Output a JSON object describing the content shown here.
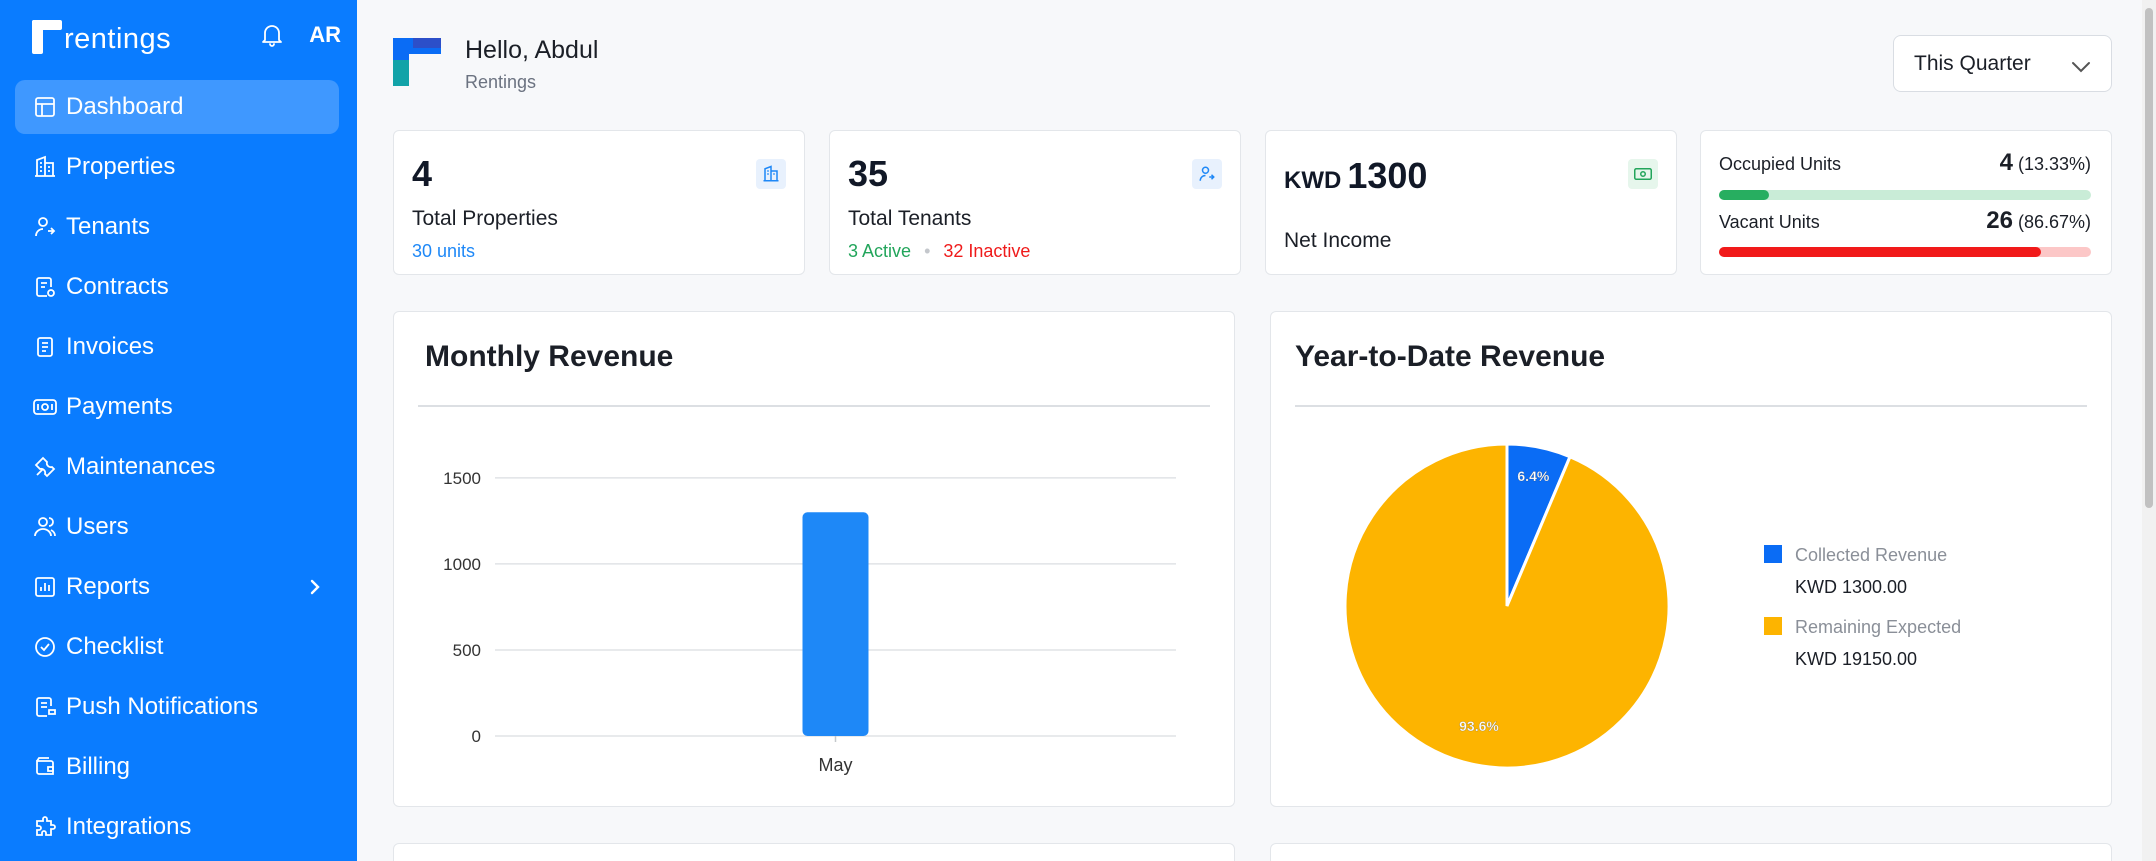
{
  "app": {
    "brand": "rentings",
    "user_initials": "AR"
  },
  "sidebar": {
    "items": [
      {
        "label": "Dashboard",
        "icon": "dashboard-icon",
        "active": true
      },
      {
        "label": "Properties",
        "icon": "building-icon"
      },
      {
        "label": "Tenants",
        "icon": "tenant-icon"
      },
      {
        "label": "Contracts",
        "icon": "contract-icon"
      },
      {
        "label": "Invoices",
        "icon": "invoice-icon"
      },
      {
        "label": "Payments",
        "icon": "payments-icon"
      },
      {
        "label": "Maintenances",
        "icon": "tools-icon"
      },
      {
        "label": "Users",
        "icon": "users-icon"
      },
      {
        "label": "Reports",
        "icon": "reports-icon",
        "has_submenu": true
      },
      {
        "label": "Checklist",
        "icon": "checklist-icon"
      },
      {
        "label": "Push Notifications",
        "icon": "notification-icon"
      },
      {
        "label": "Billing",
        "icon": "wallet-icon"
      },
      {
        "label": "Integrations",
        "icon": "puzzle-icon"
      }
    ]
  },
  "header": {
    "greeting": "Hello, Abdul",
    "org": "Rentings",
    "period": "This Quarter"
  },
  "stats": {
    "properties": {
      "value": "4",
      "label": "Total Properties",
      "sub": "30 units"
    },
    "tenants": {
      "value": "35",
      "label": "Total Tenants",
      "active": "3 Active",
      "separator": "•",
      "inactive": "32 Inactive"
    },
    "income": {
      "currency": "KWD",
      "value": "1300",
      "label": "Net Income"
    },
    "occupancy": {
      "occupied_label": "Occupied Units",
      "occupied_count": "4",
      "occupied_pct": "(13.33%)",
      "occupied_fraction": 0.1333,
      "vacant_label": "Vacant Units",
      "vacant_count": "26",
      "vacant_pct": "(86.67%)",
      "vacant_fraction": 0.8667
    }
  },
  "charts": {
    "monthly_title": "Monthly Revenue",
    "ytd_title": "Year-to-Date Revenue"
  },
  "chart_data": [
    {
      "type": "bar",
      "title": "Monthly Revenue",
      "categories": [
        "May"
      ],
      "values": [
        1300
      ],
      "yticks": [
        "0",
        "500",
        "1000",
        "1500"
      ],
      "ylim": [
        0,
        1650
      ],
      "grid": true,
      "color": "#1e88f7"
    },
    {
      "type": "pie",
      "title": "Year-to-Date Revenue",
      "slices": [
        {
          "name": "Collected Revenue",
          "value": 1300,
          "value_label": "KWD 1300.00",
          "pct_label": "6.4%",
          "color": "#0a6cf5"
        },
        {
          "name": "Remaining Expected",
          "value": 19150,
          "value_label": "KWD 19150.00",
          "pct_label": "93.6%",
          "color": "#fdb400"
        }
      ],
      "legend_position": "right"
    }
  ],
  "colors": {
    "sidebar": "#0a7cff",
    "accent": "#1e88f7",
    "active_green": "#22a55b",
    "inactive_red": "#ef1b1b",
    "occupied_bar": "#27ae60",
    "vacant_bar": "#f11a1a"
  }
}
